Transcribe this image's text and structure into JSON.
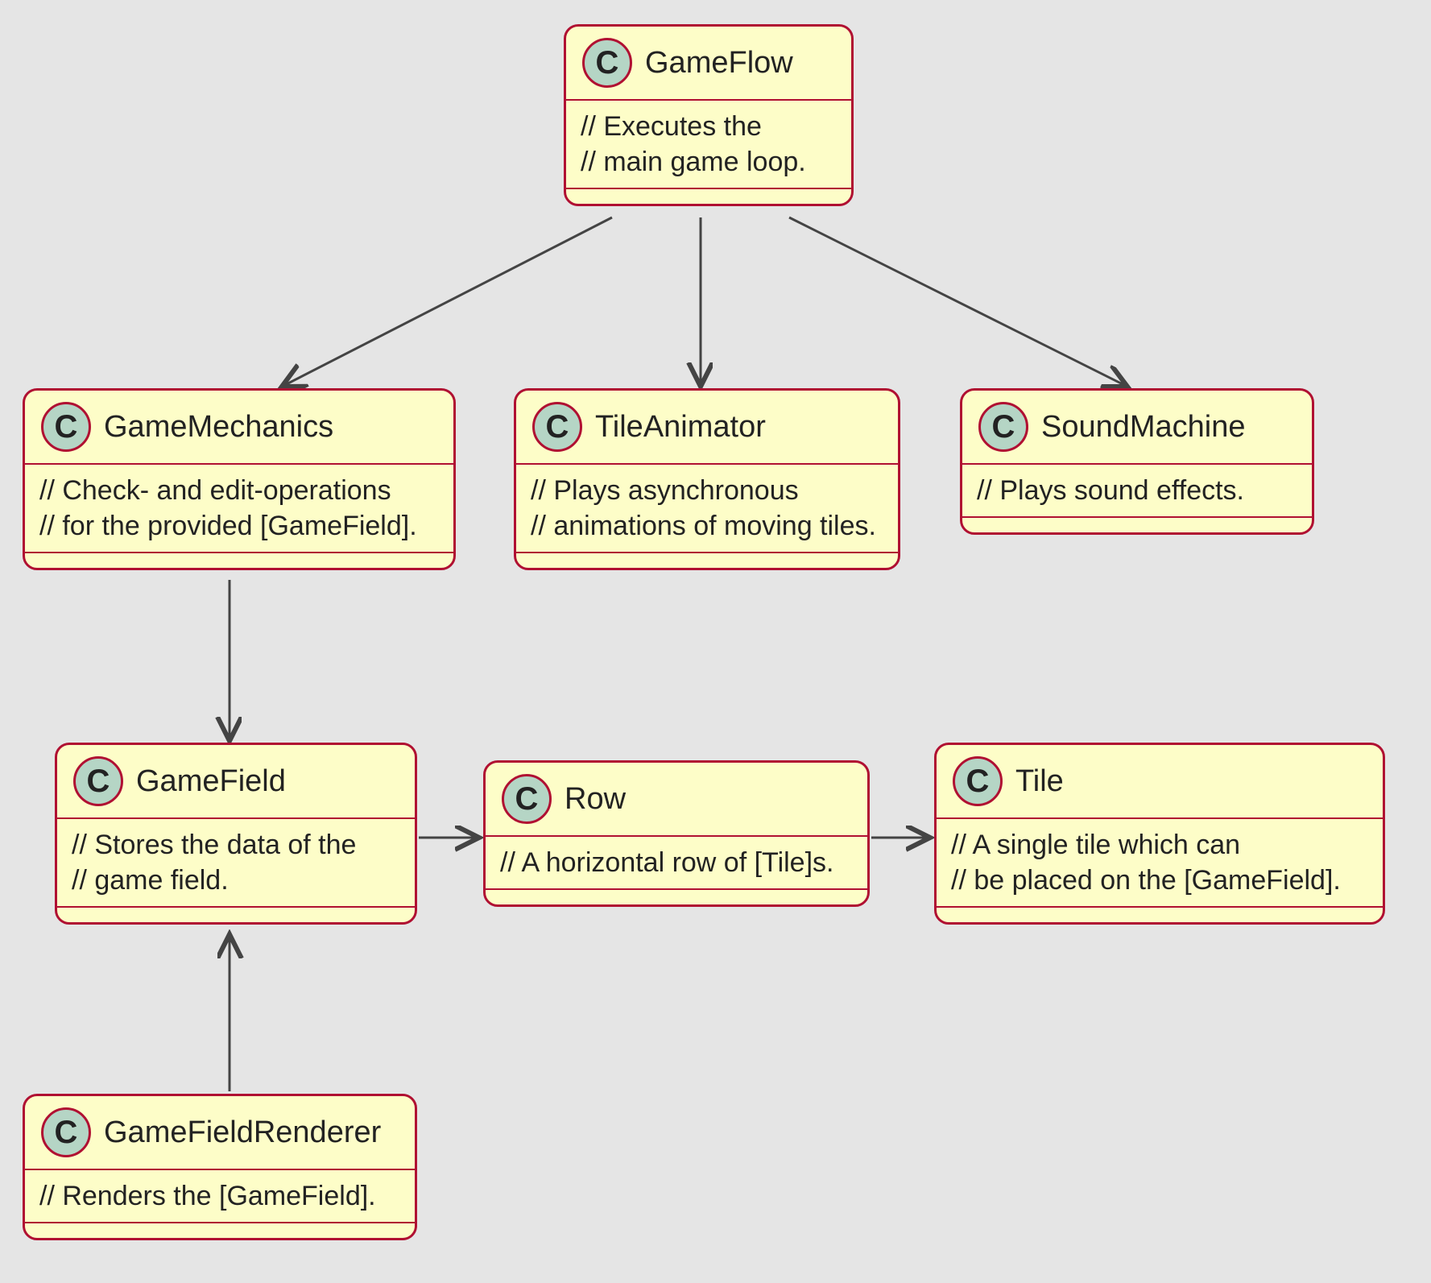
{
  "classes": {
    "gameFlow": {
      "icon": "C",
      "name": "GameFlow",
      "body": [
        "// Executes the",
        "// main game loop."
      ]
    },
    "gameMechanics": {
      "icon": "C",
      "name": "GameMechanics",
      "body": [
        "// Check- and edit-operations",
        "// for the provided [GameField]."
      ]
    },
    "tileAnimator": {
      "icon": "C",
      "name": "TileAnimator",
      "body": [
        "// Plays asynchronous",
        "// animations of moving tiles."
      ]
    },
    "soundMachine": {
      "icon": "C",
      "name": "SoundMachine",
      "body": [
        "// Plays sound effects."
      ]
    },
    "gameField": {
      "icon": "C",
      "name": "GameField",
      "body": [
        "// Stores the data of the",
        "// game field."
      ]
    },
    "row": {
      "icon": "C",
      "name": "Row",
      "body": [
        "// A horizontal row of [Tile]s."
      ]
    },
    "tile": {
      "icon": "C",
      "name": "Tile",
      "body": [
        "// A single tile which can",
        "// be placed on the [GameField]."
      ]
    },
    "gameFieldRenderer": {
      "icon": "C",
      "name": "GameFieldRenderer",
      "body": [
        "// Renders the [GameField]."
      ]
    }
  }
}
